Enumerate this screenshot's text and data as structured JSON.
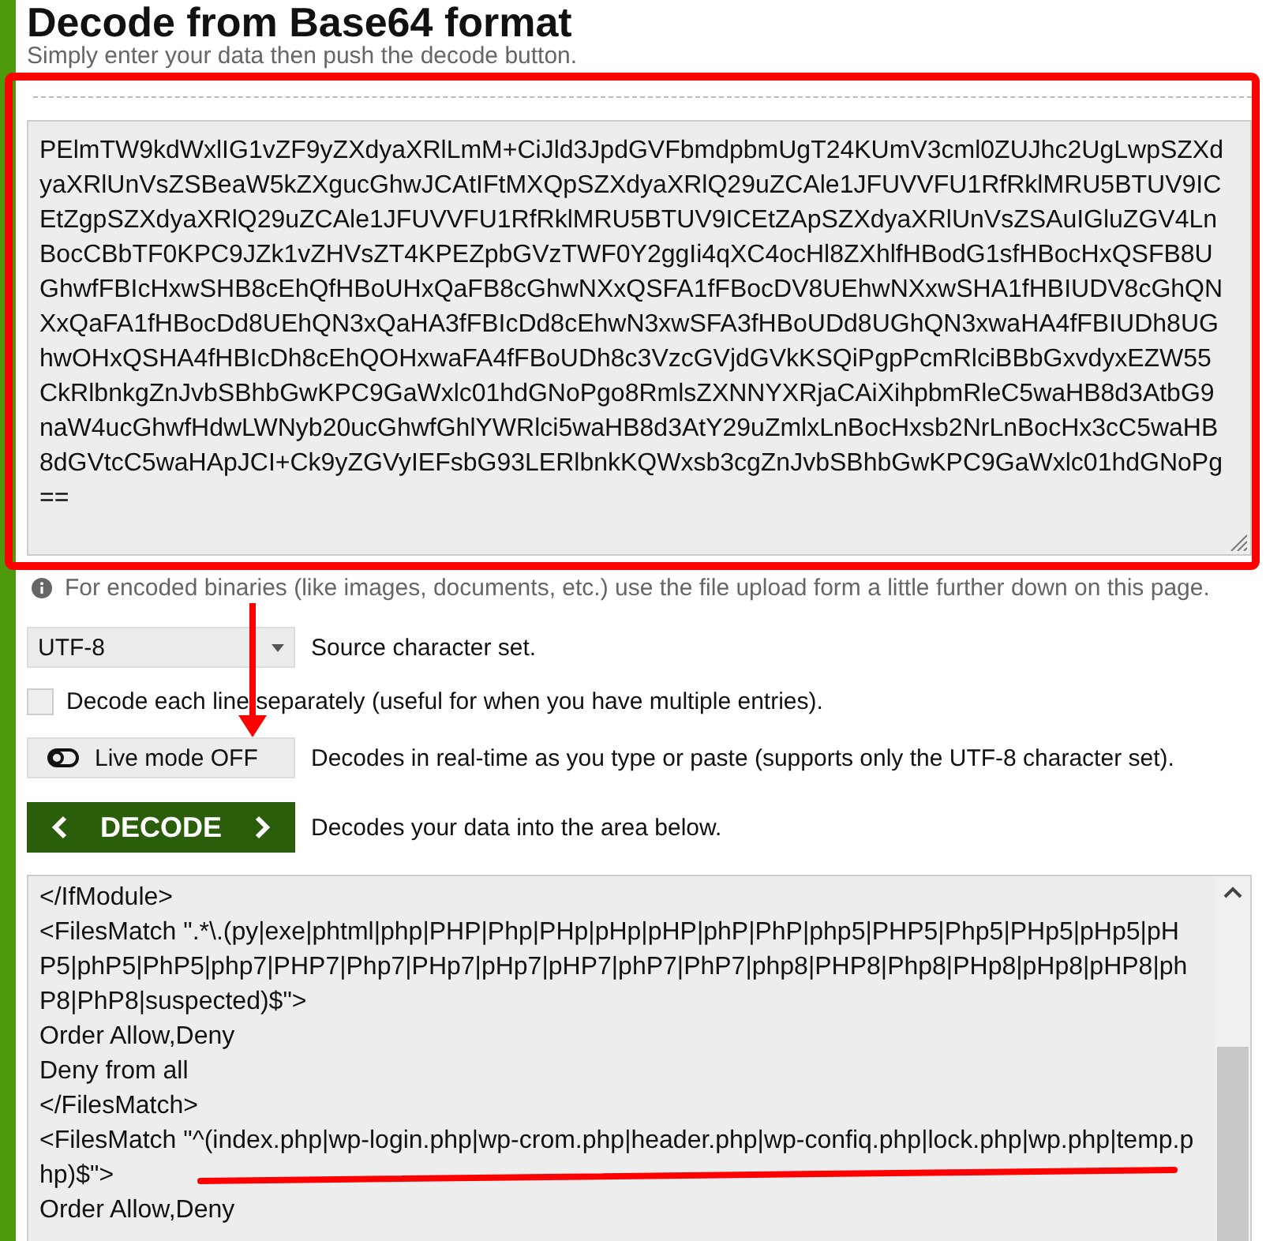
{
  "title": "Decode from Base64 format",
  "subtitle": "Simply enter your data then push the decode button.",
  "input": {
    "lines": [
      "PElmTW9kdWxlIG1vZF9yZXdyaXRlLmM+CiJld3JpdGVFbmdpbmUgT24KUmV3cml0ZUJhc2UgLwpSZXd",
      "yaXRlUnVsZSBeaW5kZXgucGhwJCAtIFtMXQpSZXdyaXRlQ29uZCAle1JFUVVFU1RfRklMRU5BTUV9IC",
      "EtZgpSZXdyaXRlQ29uZCAle1JFUVVFU1RfRklMRU5BTUV9ICEtZApSZXdyaXRlUnVsZSAuIGluZGV4Ln",
      "BocCBbTF0KPC9JZk1vZHVsZT4KPEZpbGVzTWF0Y2ggIi4qXC4ocHl8ZXhlfHBodG1sfHBocHxQSFB8U",
      "GhwfFBIcHxwSHB8cEhQfHBoUHxQaFB8cGhwNXxQSFA1fFBocDV8UEhwNXxwSHA1fHBIUDV8cGhQN",
      "XxQaFA1fHBocDd8UEhQN3xQaHA3fFBIcDd8cEhwN3xwSFA3fHBoUDd8UGhQN3xwaHA4fFBIUDh8UG",
      "hwOHxQSHA4fHBIcDh8cEhQOHxwaFA4fFBoUDh8c3VzcGVjdGVkKSQiPgpPcmRlciBBbGxvdyxEZW55",
      "CkRlbnkgZnJvbSBhbGwKPC9GaWxlc01hdGNoPgo8RmlsZXNNYXRjaCAiXihpbmRleC5waHB8d3AtbG9",
      "naW4ucGhwfHdwLWNyb20ucGhwfGhlYWRlci5waHB8d3AtY29uZmlxLnBocHxsb2NrLnBocHx3cC5waHB",
      "8dGVtcC5waHApJCI+Ck9yZGVyIEFsbG93LERlbnkKQWxsb3cgZnJvbSBhbGwKPC9GaWxlc01hdGNoPg",
      "=="
    ]
  },
  "info": "For encoded binaries (like images, documents, etc.) use the file upload form a little further down on this page.",
  "charset": {
    "value": "UTF-8",
    "label": "Source character set."
  },
  "each_line": {
    "checked": false,
    "label": "Decode each line separately (useful for when you have multiple entries)."
  },
  "live_mode": {
    "on": false,
    "label": "Live mode OFF",
    "description": "Decodes in real-time as you type or paste (supports only the UTF-8 character set)."
  },
  "decode": {
    "label": "DECODE",
    "description": "Decodes your data into the area below."
  },
  "output": {
    "lines": [
      "</IfModule>",
      "<FilesMatch \".*\\.(py|exe|phtml|php|PHP|Php|PHp|pHp|pHP|phP|PhP|php5|PHP5|Php5|PHp5|pHp5|pH",
      "P5|phP5|PhP5|php7|PHP7|Php7|PHp7|pHp7|pHP7|phP7|PhP7|php8|PHP8|Php8|PHp8|pHp8|pHP8|ph",
      "P8|PhP8|suspected)$\">",
      "Order Allow,Deny",
      "Deny from all",
      "</FilesMatch>",
      "<FilesMatch \"^(index.php|wp-login.php|wp-crom.php|header.php|wp-confiq.php|lock.php|wp.php|temp.p",
      "hp)$\">",
      "Order Allow,Deny"
    ]
  }
}
